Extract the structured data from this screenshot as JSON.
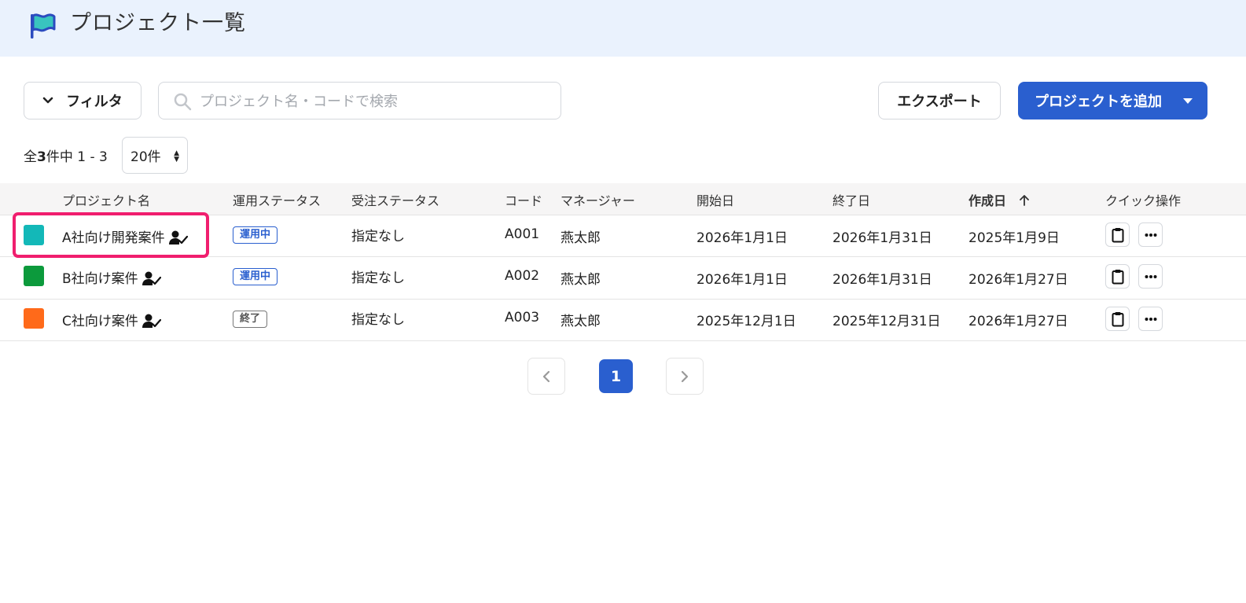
{
  "header": {
    "title": "プロジェクト一覧",
    "icon": "flag-icon"
  },
  "toolbar": {
    "filter_label": "フィルタ",
    "search_placeholder": "プロジェクト名・コードで検索",
    "export_label": "エクスポート",
    "add_label": "プロジェクトを追加"
  },
  "summary": {
    "prefix": "全",
    "total": "3",
    "suffix": "件中 1 - 3",
    "per_page": "20件"
  },
  "table": {
    "columns": {
      "name": "プロジェクト名",
      "op_status": "運用ステータス",
      "order_status": "受注ステータス",
      "code": "コード",
      "manager": "マネージャー",
      "start": "開始日",
      "end": "終了日",
      "created": "作成日",
      "quick": "クイック操作"
    },
    "sort": {
      "column": "作成日",
      "direction": "ascending"
    },
    "rows": [
      {
        "color": "#13b8b8",
        "name": "A社向け開発案件",
        "op_status": "運用中",
        "order_status": "指定なし",
        "code": "A001",
        "manager": "燕太郎",
        "start": "2026年1月1日",
        "end": "2026年1月31日",
        "created": "2025年1月9日"
      },
      {
        "color": "#0c9a3c",
        "name": "B社向け案件",
        "op_status": "運用中",
        "order_status": "指定なし",
        "code": "A002",
        "manager": "燕太郎",
        "start": "2026年1月1日",
        "end": "2026年1月31日",
        "created": "2026年1月27日"
      },
      {
        "color": "#ff6a1a",
        "name": "C社向け案件",
        "op_status": "終了",
        "order_status": "指定なし",
        "code": "A003",
        "manager": "燕太郎",
        "start": "2025年12月1日",
        "end": "2025年12月31日",
        "created": "2026年1月27日"
      }
    ]
  },
  "pagination": {
    "current": "1"
  },
  "colors": {
    "accent": "#2a5fcf",
    "highlight": "#f01e6e",
    "header_bg": "#eaf2fd"
  }
}
